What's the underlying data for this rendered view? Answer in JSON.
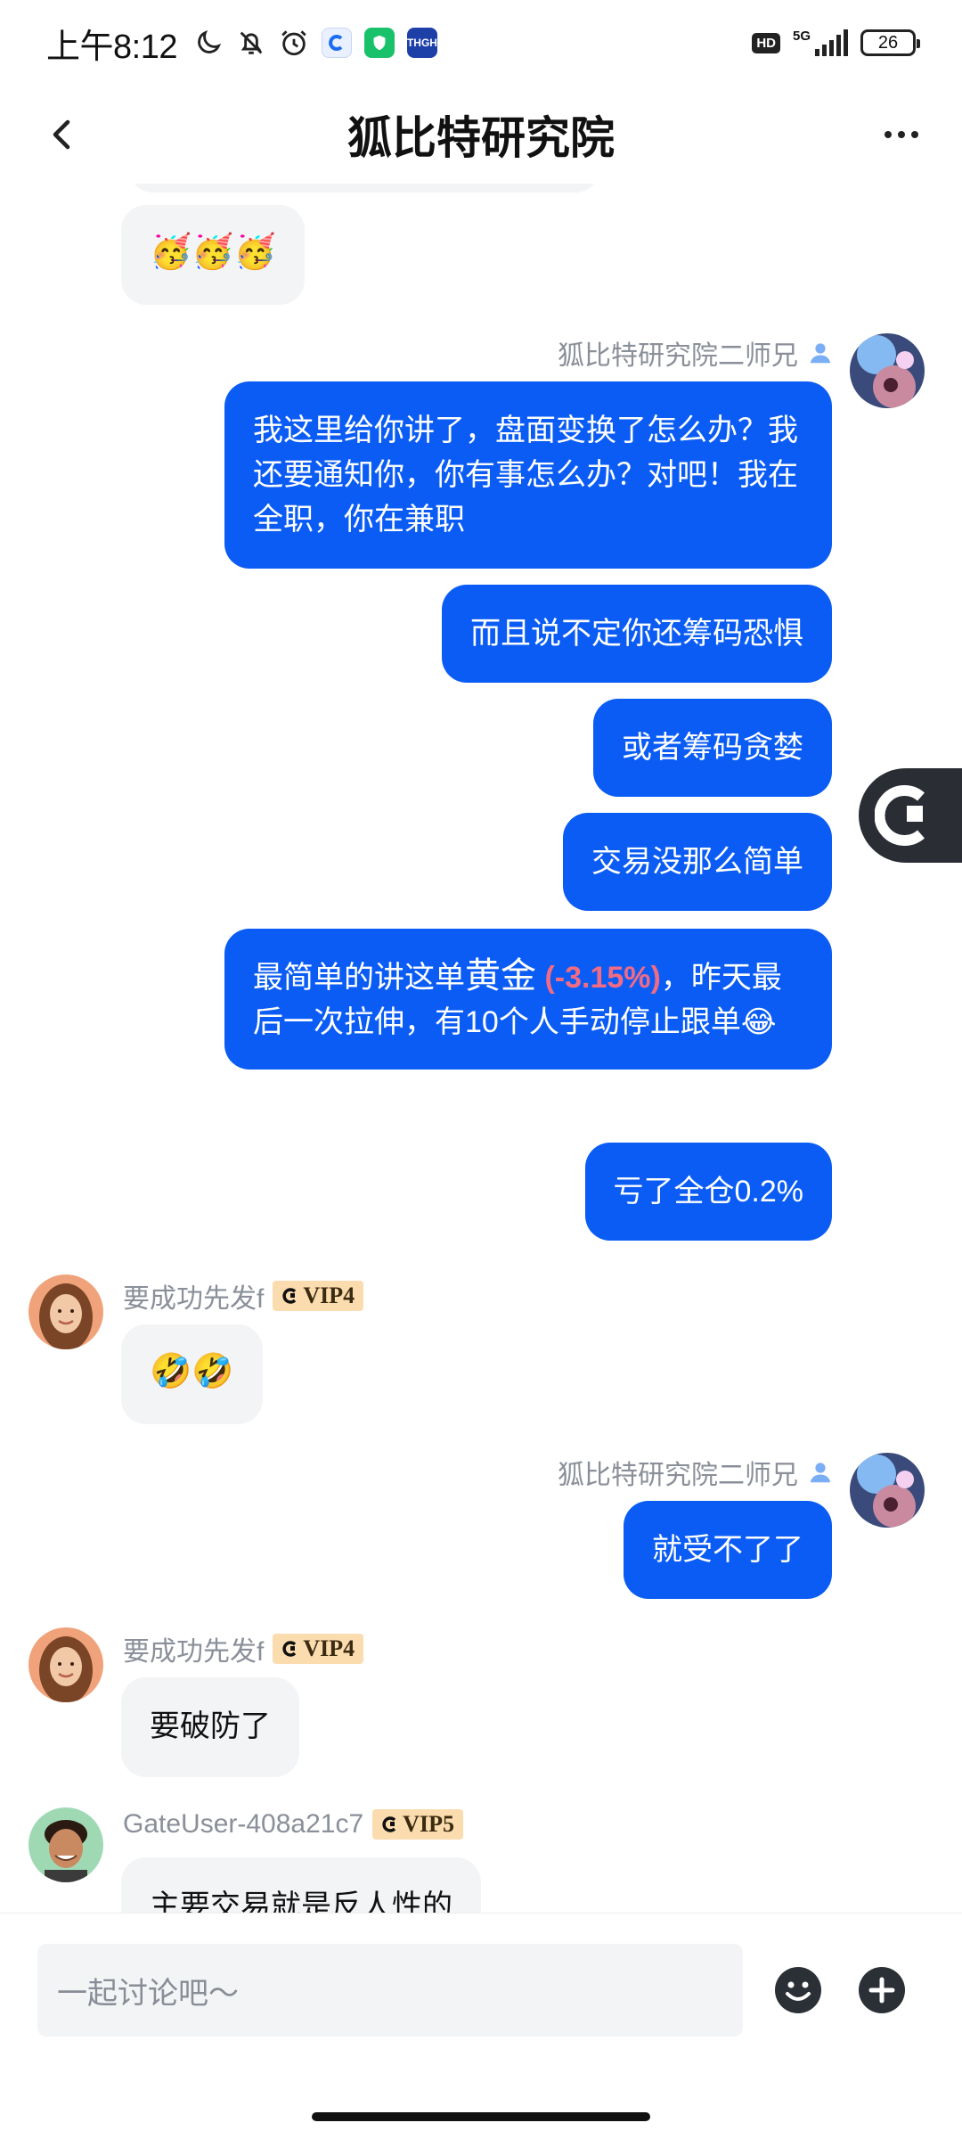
{
  "status_bar": {
    "time": "上午8:12",
    "network": "5G",
    "hd": "HD",
    "battery": "26",
    "app_icon_label": "THGH"
  },
  "header": {
    "title": "狐比特研究院",
    "back_icon": "chevron-left-icon",
    "more_icon": "more-horizontal-icon"
  },
  "colors": {
    "outgoing_bubble": "#0a5cf5",
    "incoming_bubble": "#f3f4f6",
    "negative_change": "#f26b84",
    "vip_badge": "#fbdcae"
  },
  "messages": {
    "m0": {
      "text": "🥳🥳🥳"
    },
    "s1": {
      "sender": "狐比特研究院二师兄"
    },
    "m1": {
      "text": "我这里给你讲了，盘面变换了怎么办？我还要通知你，你有事怎么办？对吧！我在全职，你在兼职"
    },
    "m2": {
      "text": "而且说不定你还筹码恐惧"
    },
    "m3": {
      "text": "或者筹码贪婪"
    },
    "m4": {
      "text": "交易没那么简单"
    },
    "m5": {
      "prefix": "最简单的讲这单",
      "asset": "黄金",
      "change": "(-3.15%)",
      "suffix": "，昨天最后一次拉伸，有10个人手动停止跟单😂"
    },
    "m6": {
      "text": "亏了全仓0.2%"
    },
    "s7": {
      "sender": "要成功先发f",
      "vip": "VIP4"
    },
    "m7": {
      "text": "🤣🤣"
    },
    "s8": {
      "sender": "狐比特研究院二师兄"
    },
    "m8": {
      "text": "就受不了了"
    },
    "s9": {
      "sender": "要成功先发f",
      "vip": "VIP4"
    },
    "m9": {
      "text": "要破防了"
    },
    "s10": {
      "sender": "GateUser-408a21c7",
      "vip": "VIP5"
    },
    "m10": {
      "text": "主要交易就是反人性的"
    }
  },
  "input": {
    "placeholder": "一起讨论吧～",
    "emoji_icon": "smile-icon",
    "plus_icon": "plus-circle-icon"
  }
}
